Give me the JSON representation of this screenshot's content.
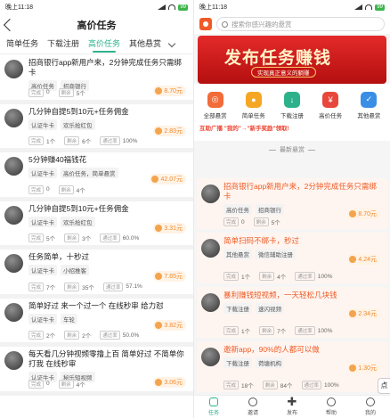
{
  "left": {
    "status_time": "晚上11:18",
    "battery": "99",
    "nav_title": "高价任务",
    "tabs": [
      "简单任务",
      "下载注册",
      "高价任务",
      "其他悬赏"
    ],
    "tasks": [
      {
        "title": "招商银行app新用户来，2分钟完成任务只需绑卡",
        "tags": [
          "高价任务",
          "招商银行"
        ],
        "price": "8.70元",
        "done": "0",
        "left": "5个",
        "rate": ""
      },
      {
        "title": "几分钟自提5到10元+任务佣金",
        "tags": [
          "认证牛卡",
          "欢乐抢红包"
        ],
        "price": "2.83元",
        "done": "1个",
        "left": "6个",
        "rate": "100%"
      },
      {
        "title": "5分钟赚40福钱花",
        "tags": [
          "认证牛卡",
          "高价任务，简单悬赏"
        ],
        "price": "42.07元",
        "done": "0",
        "left": "4个",
        "rate": ""
      },
      {
        "title": "几分钟自提5到10元+任务佣金",
        "tags": [
          "认证牛卡",
          "欢乐抢红包"
        ],
        "price": "3.31元",
        "done": "5个",
        "left": "3个",
        "rate": "60.0%"
      },
      {
        "title": "任务简单，十秒过",
        "tags": [
          "认证牛卡",
          "小招推客"
        ],
        "price": "7.65元",
        "done": "7个",
        "left": "35个",
        "rate": "57.1%"
      },
      {
        "title": "简单好过 来一个过一个 在线秒审 给力怼",
        "tags": [
          "认证牛卡",
          "车轮"
        ],
        "price": "3.82元",
        "done": "2个",
        "left": "2个",
        "rate": "50.0%"
      },
      {
        "title": "每天看几分钟视频零撸上百 简单好过 不简单你打我 在线秒审",
        "tags": [
          "认证牛卡",
          "秘乐短视频"
        ],
        "price": "3.06元",
        "done": "0",
        "left": "4个",
        "rate": ""
      }
    ],
    "stat_labels": {
      "done": "完成",
      "left": "剩余",
      "rate": "通过率"
    }
  },
  "right": {
    "status_time": "晚上11:18",
    "battery": "99",
    "search_placeholder": "搜索你感兴趣的悬赏",
    "banner_title": "发布任务赚钱",
    "banner_sub": "实现真正意义的躺赚",
    "categories": [
      "全部悬赏",
      "简单任务",
      "下载注册",
      "高价任务",
      "其他悬赏"
    ],
    "promo": "互助广播 \"我的\"→\"新手奖励\"领取!",
    "section_title": "最新悬赏",
    "tasks": [
      {
        "title": "招商银行app新用户来，2分钟完成任务只需绑卡",
        "tags": [
          "高价任务",
          "招商银行"
        ],
        "price": "8.70元",
        "done": "0",
        "left": "5个",
        "rate": ""
      },
      {
        "title": "简单扫码不绑卡，秒过",
        "tags": [
          "其他悬赏",
          "微信辅助注册"
        ],
        "price": "4.24元",
        "done": "1个",
        "left": "4个",
        "rate": "100%"
      },
      {
        "title": "暴利赚钱短视频，一天轻松几块钱",
        "tags": [
          "下载注册",
          "速闪视频"
        ],
        "price": "2.34元",
        "done": "1个",
        "left": "7个",
        "rate": "100%"
      },
      {
        "title": "邀新app，90%的人都可以做",
        "tags": [
          "下载注册",
          "荷塘机构"
        ],
        "price": "1.30元",
        "done": "18个",
        "left": "84个",
        "rate": "100%"
      }
    ],
    "tabbar": [
      "任务",
      "邀请",
      "发布",
      "帮助",
      "我的"
    ]
  },
  "colors": {
    "accent": "#2db18b",
    "orange": "#f08a2e",
    "banner": "#e42a2a"
  }
}
